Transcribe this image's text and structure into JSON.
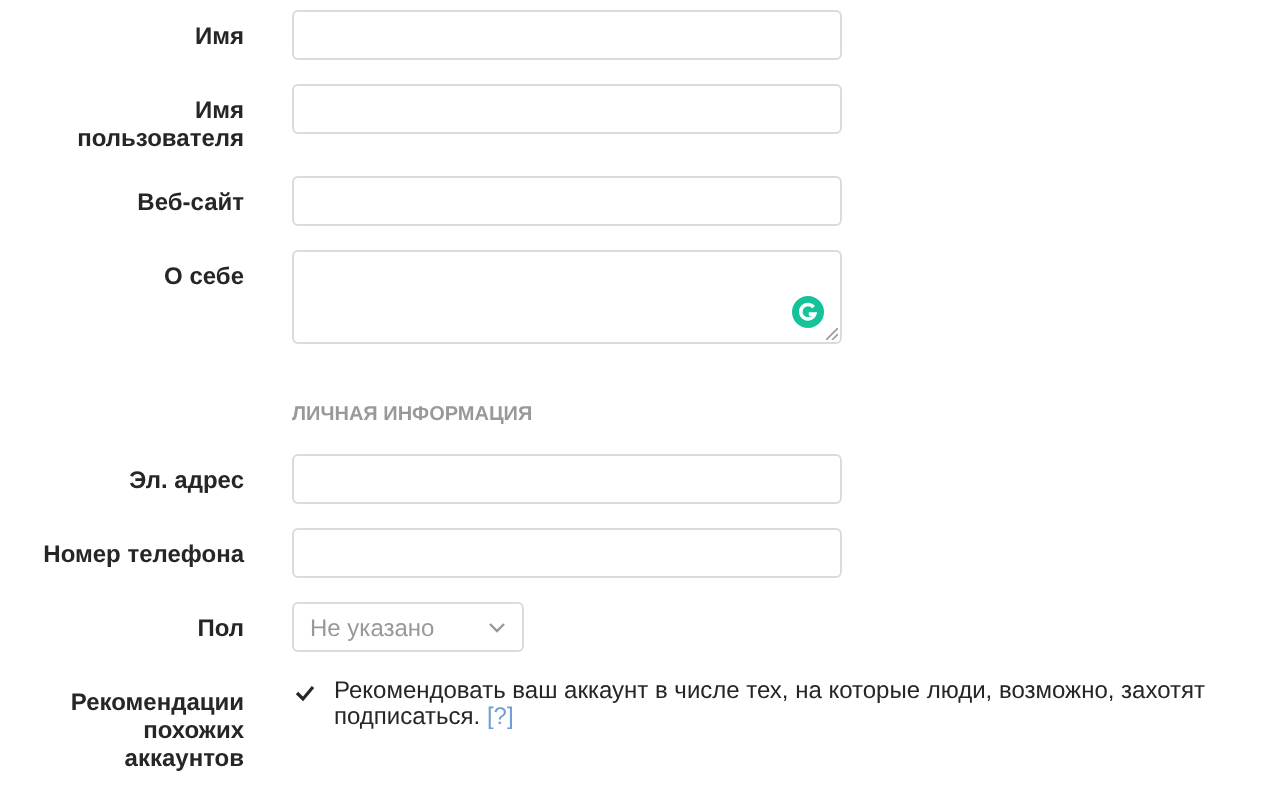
{
  "form": {
    "rows": [
      {
        "kind": "text",
        "label": "Имя"
      },
      {
        "kind": "text",
        "label": "Имя пользователя"
      },
      {
        "kind": "text",
        "label": "Веб-сайт"
      },
      {
        "kind": "textarea",
        "label": "О себе"
      },
      {
        "kind": "section",
        "label": "ЛИЧНАЯ ИНФОРМАЦИЯ"
      },
      {
        "kind": "text",
        "label": "Эл. адрес"
      },
      {
        "kind": "text",
        "label": "Номер телефона"
      },
      {
        "kind": "select",
        "label": "Пол",
        "value": "Не указано"
      },
      {
        "kind": "checkbox",
        "label": "Рекомендации похожих аккаунтов",
        "checked": true,
        "text": "Рекомендовать ваш аккаунт в числе тех, на которые люди, возможно, захотят подписаться.",
        "link": "[?]"
      }
    ]
  }
}
